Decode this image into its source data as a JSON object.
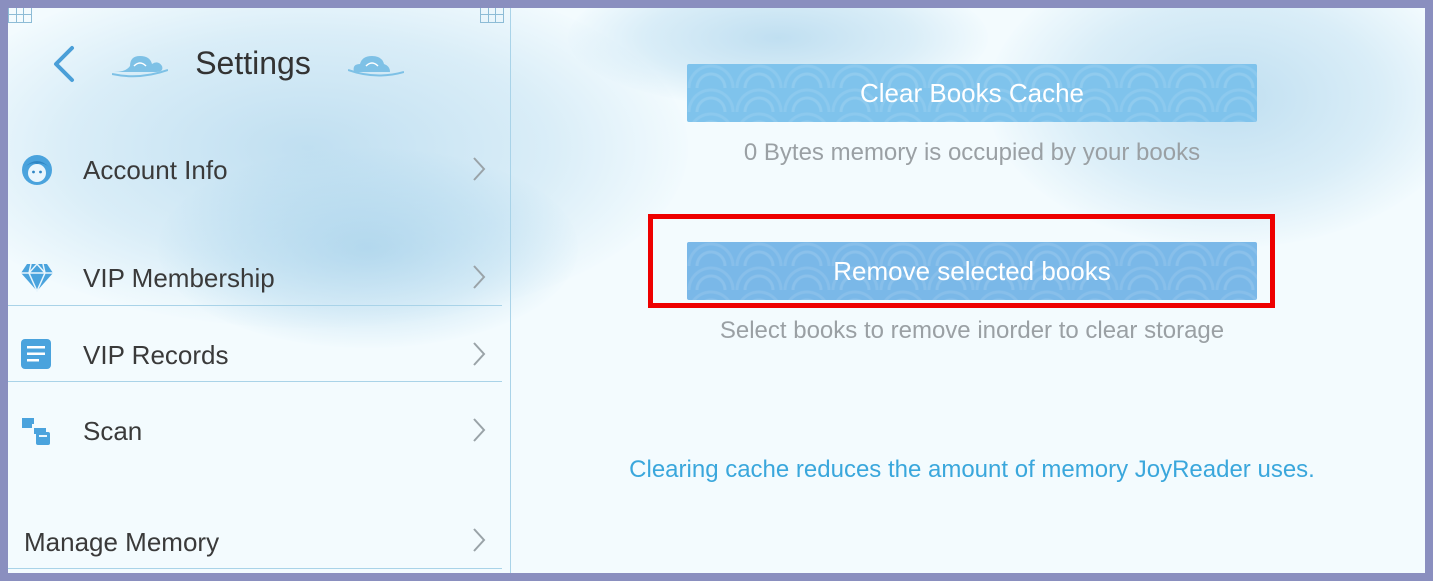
{
  "header": {
    "title": "Settings"
  },
  "sidebar": {
    "items": [
      {
        "label": "Account Info",
        "icon": "face-icon"
      },
      {
        "label": "VIP Membership",
        "icon": "diamond-icon"
      },
      {
        "label": "VIP Records",
        "icon": "document-icon"
      },
      {
        "label": "Scan",
        "icon": "scan-icon"
      },
      {
        "label": "Manage Memory",
        "icon": ""
      }
    ]
  },
  "main": {
    "clear_cache": {
      "label": "Clear Books Cache",
      "caption": "0 Bytes memory is occupied by your books"
    },
    "remove_books": {
      "label": "Remove selected books",
      "caption": "Select books to remove inorder to clear storage"
    },
    "note": "Clearing cache reduces the amount of memory JoyReader uses."
  },
  "colors": {
    "accent": "#4a9fd8",
    "button": "#7fc3ec",
    "highlight": "#ee0000",
    "note_text": "#3aa7dc"
  }
}
